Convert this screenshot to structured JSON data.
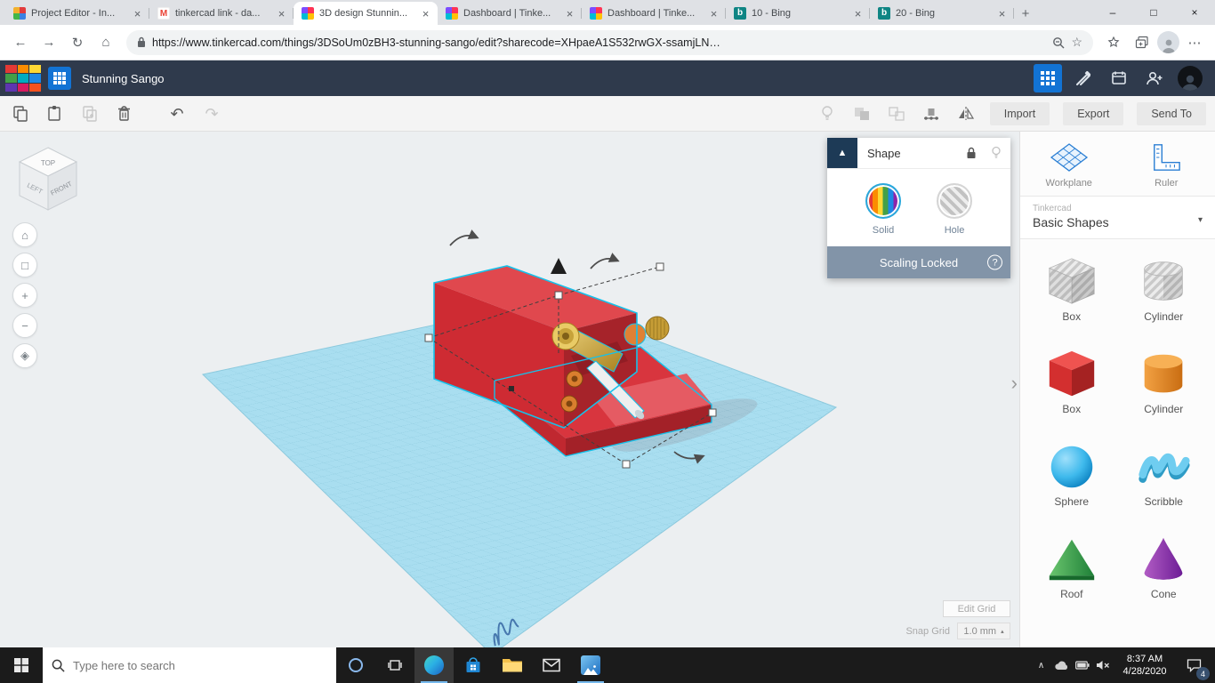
{
  "icons": {
    "close": "×",
    "new_tab": "+",
    "minimize": "–",
    "maximize": "□",
    "window_close": "×",
    "back": "←",
    "forward": "→",
    "reload": "↻",
    "home": "⌂",
    "ellipsis": "⋯",
    "star": "☆",
    "gmail_m": "M",
    "bing_b": "b",
    "panel_collapse": "▲",
    "question": "?",
    "chevron_down": "▾",
    "snap_caret": "▴",
    "sidebar_collapse": "›",
    "cam_home": "⌂",
    "cam_fit": "□",
    "zoom_in": "+",
    "zoom_out": "−",
    "cam_persp": "◈",
    "undo": "↶",
    "redo": "↷",
    "tray_chevron": "∧"
  },
  "browser": {
    "tabs": [
      {
        "title": "Project Editor - In..."
      },
      {
        "title": "tinkercad link - da..."
      },
      {
        "title": "3D design Stunnin..."
      },
      {
        "title": "Dashboard | Tinke..."
      },
      {
        "title": "Dashboard | Tinke..."
      },
      {
        "title": "10 - Bing"
      },
      {
        "title": "20 - Bing"
      }
    ],
    "url": "https://www.tinkercad.com/things/3DSoUm0zBH3-stunning-sango/edit?sharecode=XHpaeA1S532rwGX-ssamjLN…"
  },
  "header": {
    "logo_alt": "TINKERCAD",
    "design_name": "Stunning Sango"
  },
  "toolbar": {
    "import_label": "Import",
    "export_label": "Export",
    "send_to_label": "Send To"
  },
  "viewport": {
    "view_cube": {
      "top": "TOP",
      "front": "FRONT",
      "left": "LEFT"
    },
    "edit_grid_label": "Edit Grid",
    "snap_grid_label": "Snap Grid",
    "snap_grid_value": "1.0 mm"
  },
  "inspector": {
    "title": "Shape",
    "solid_label": "Solid",
    "hole_label": "Hole",
    "scaling_locked_label": "Scaling Locked"
  },
  "sidebar": {
    "workplane_label": "Workplane",
    "ruler_label": "Ruler",
    "library_brand": "Tinkercad",
    "library_name": "Basic Shapes",
    "shapes": [
      {
        "label": "Box"
      },
      {
        "label": "Cylinder"
      },
      {
        "label": "Box"
      },
      {
        "label": "Cylinder"
      },
      {
        "label": "Sphere"
      },
      {
        "label": "Scribble"
      },
      {
        "label": "Roof"
      },
      {
        "label": "Cone"
      }
    ]
  },
  "taskbar": {
    "search_placeholder": "Type here to search",
    "clock_time": "8:37 AM",
    "clock_date": "4/28/2020",
    "notification_count": "4"
  },
  "colors": {
    "tinkercad_header": "#2f3a4c",
    "accent_blue": "#1273d4",
    "workplane_blue": "#a9def0",
    "selection_cyan": "#16c1ea",
    "model_red": "#ce2b33",
    "scaling_bar": "#8294a8",
    "taskbar_dark": "#1b1b1b"
  }
}
